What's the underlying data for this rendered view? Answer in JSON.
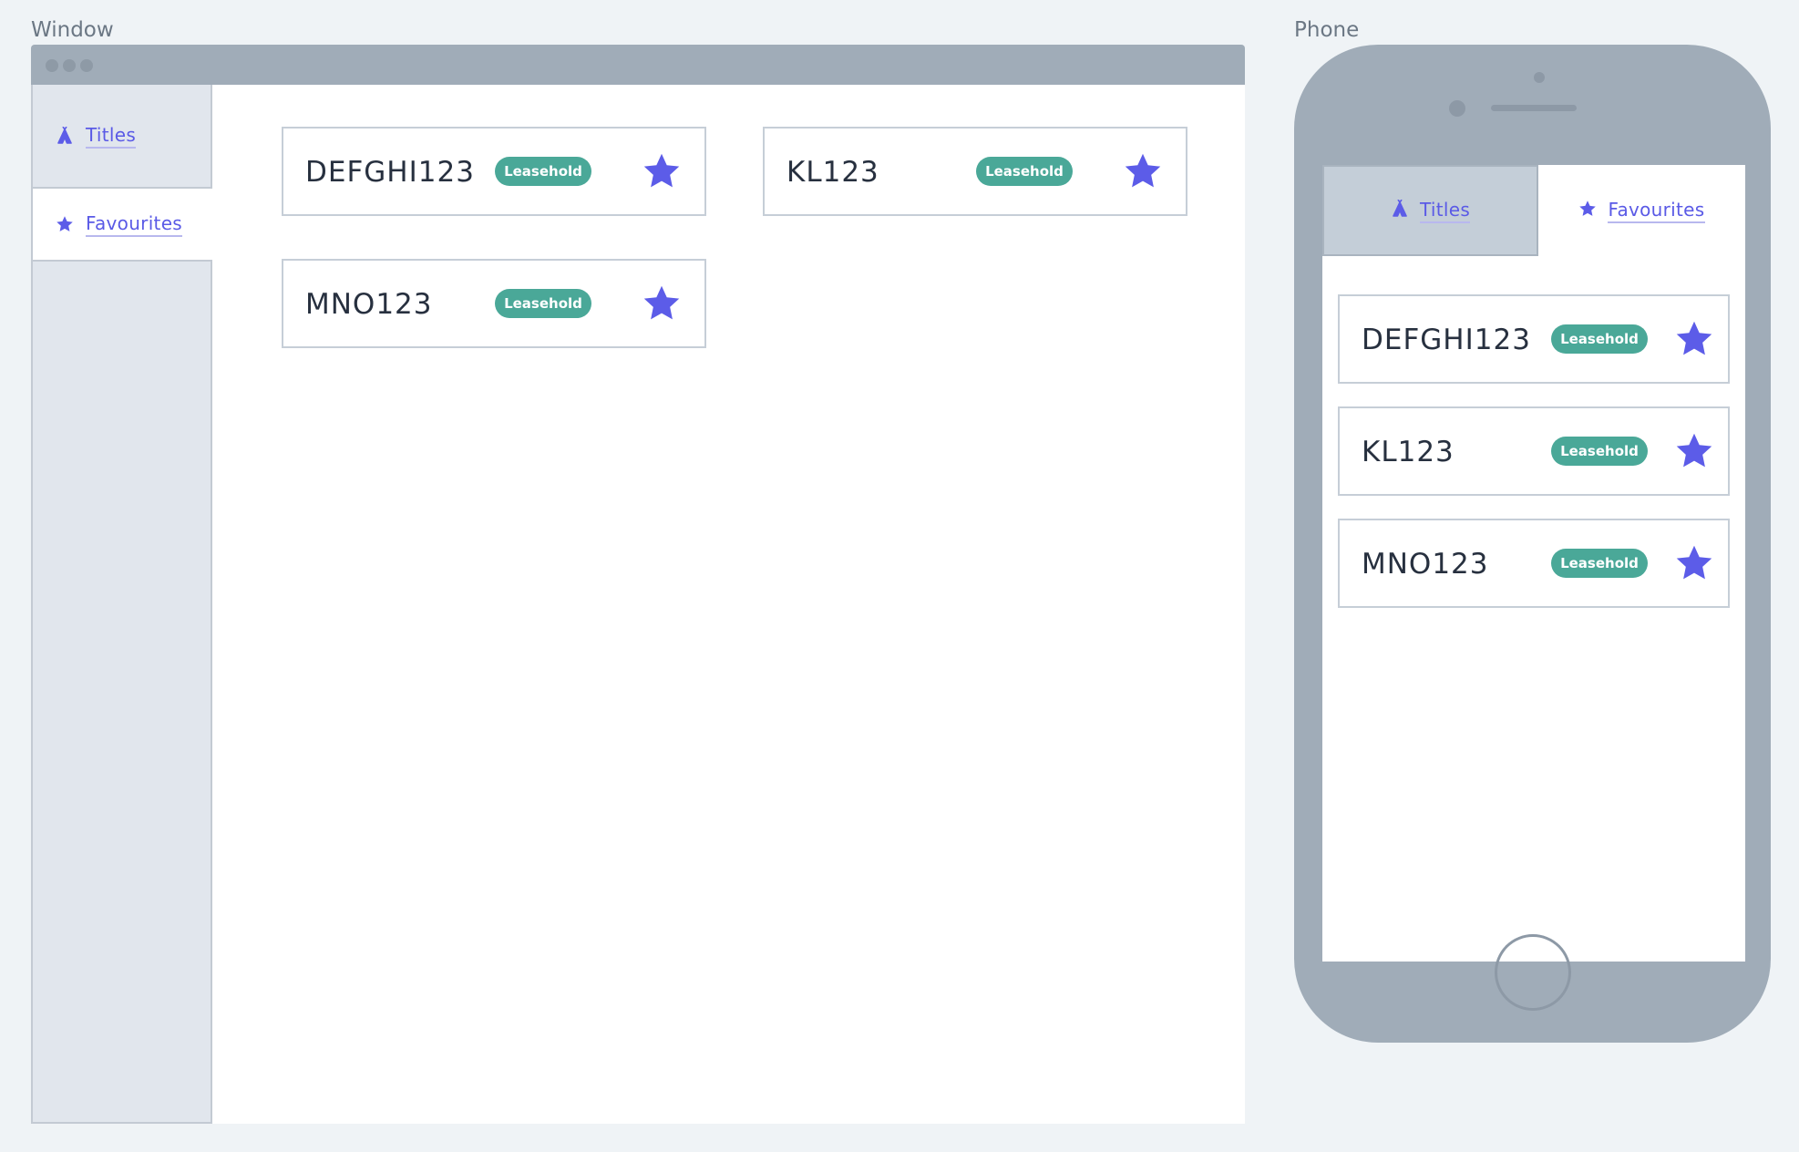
{
  "labels": {
    "window": "Window",
    "phone": "Phone"
  },
  "nav": {
    "titles_label": "Titles",
    "favourites_label": "Favourites",
    "active": "Favourites"
  },
  "favourites": [
    {
      "code": "DEFGHI123",
      "badge": "Leasehold",
      "starred": true
    },
    {
      "code": "KL123",
      "badge": "Leasehold",
      "starred": true
    },
    {
      "code": "MNO123",
      "badge": "Leasehold",
      "starred": true
    }
  ],
  "icons": {
    "titles": "tent-icon",
    "favourites": "star-icon"
  },
  "colors": {
    "accent": "#5c5ce8",
    "badge": "#4aa898",
    "frame": "#a0acb8",
    "sidebar": "#e1e6ed",
    "border": "#c6ced7"
  }
}
